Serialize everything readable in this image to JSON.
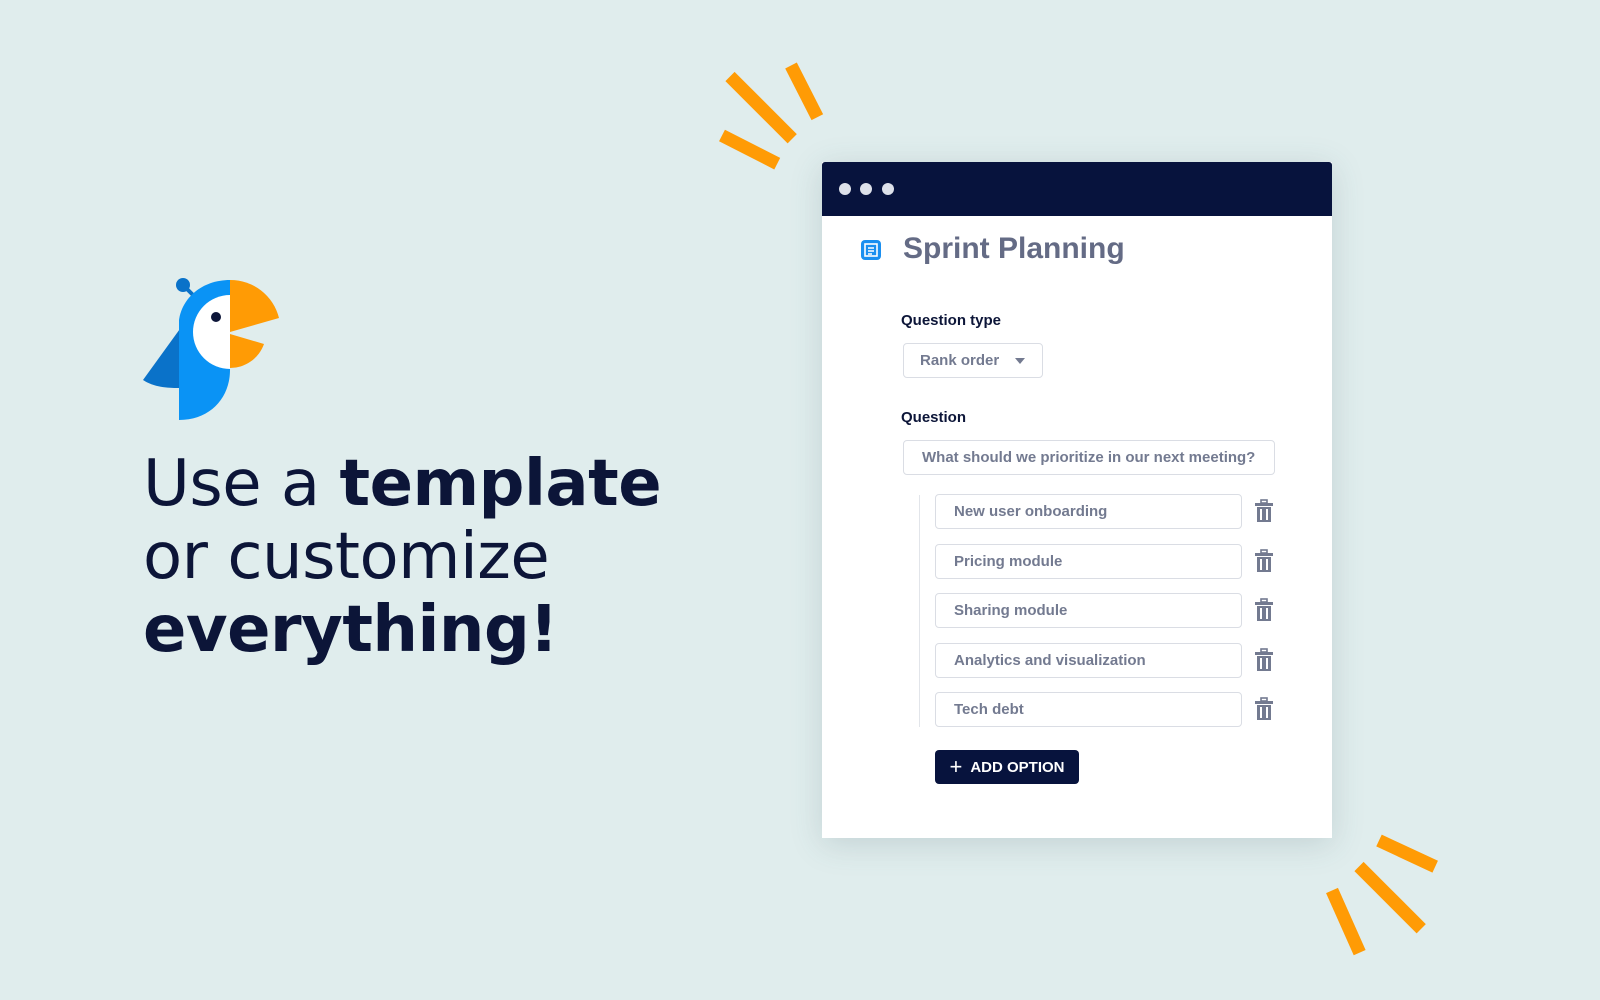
{
  "headline": {
    "line1_regular": "Use a ",
    "line1_bold": "template",
    "line2": "or customize",
    "line3": "everything!"
  },
  "colors": {
    "background": "#e0eded",
    "accent_orange": "#ff9b05",
    "navy": "#07133d",
    "brand_blue": "#0a93f5"
  },
  "logo": {
    "icon": "parrot-logo-icon"
  },
  "window": {
    "title": "Sprint Planning",
    "title_icon": "document-icon",
    "question_type_label": "Question type",
    "question_type_value": "Rank order",
    "question_label": "Question",
    "question_value": "What should we prioritize in our next meeting?",
    "options": [
      {
        "label": "New user onboarding"
      },
      {
        "label": "Pricing module"
      },
      {
        "label": "Sharing module"
      },
      {
        "label": "Analytics and visualization"
      },
      {
        "label": "Tech debt"
      }
    ],
    "add_option_label": "ADD OPTION"
  }
}
